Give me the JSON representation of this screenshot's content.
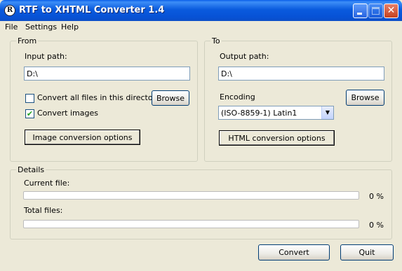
{
  "window": {
    "title": "RTF to XHTML Converter 1.4",
    "app_icon_glyph": "R"
  },
  "menu": {
    "items": [
      "File",
      "Settings",
      "Help"
    ]
  },
  "from": {
    "legend": "From",
    "input_label": "Input path:",
    "input_value": "D:\\",
    "convert_all_label": "Convert all files in this directory",
    "convert_all_checked": false,
    "convert_images_label": "Convert images",
    "convert_images_checked": true,
    "browse_label": "Browse",
    "image_options_label": "Image conversion options"
  },
  "to": {
    "legend": "To",
    "output_label": "Output path:",
    "output_value": "D:\\",
    "encoding_label": "Encoding",
    "encoding_value": "(ISO-8859-1) Latin1",
    "browse_label": "Browse",
    "html_options_label": "HTML conversion options"
  },
  "details": {
    "legend": "Details",
    "current_file_label": "Current file:",
    "current_file_percent_text": "0 %",
    "current_file_progress": 0,
    "total_files_label": "Total files:",
    "total_files_percent_text": "0 %",
    "total_files_progress": 0
  },
  "actions": {
    "convert_label": "Convert",
    "quit_label": "Quit"
  },
  "icons": {
    "check_glyph": "✔",
    "dropdown_glyph": "▼",
    "close_glyph": "✕"
  }
}
